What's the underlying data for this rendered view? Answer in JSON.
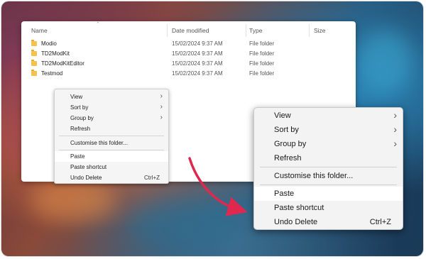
{
  "explorer": {
    "columns": [
      "Name",
      "Date modified",
      "Type",
      "Size"
    ],
    "rows": [
      {
        "name": "Modio",
        "date": "15/02/2024 9:37 AM",
        "type": "File folder",
        "icon": "folder-icon"
      },
      {
        "name": "TD2ModKit",
        "date": "15/02/2024 9:37 AM",
        "type": "File folder",
        "icon": "folder-icon"
      },
      {
        "name": "TD2ModKitEditor",
        "date": "15/02/2024 9:37 AM",
        "type": "File folder",
        "icon": "folder-icon"
      },
      {
        "name": "Testmod",
        "date": "15/02/2024 9:37 AM",
        "type": "File folder",
        "icon": "folder-icon"
      }
    ]
  },
  "context_menu": {
    "items": [
      {
        "label": "View",
        "submenu": true
      },
      {
        "label": "Sort by",
        "submenu": true
      },
      {
        "label": "Group by",
        "submenu": true
      },
      {
        "label": "Refresh"
      },
      {
        "label": "Customise this folder..."
      },
      {
        "label": "Paste",
        "highlighted": true
      },
      {
        "label": "Paste shortcut"
      },
      {
        "label": "Undo Delete",
        "shortcut": "Ctrl+Z"
      }
    ]
  },
  "colors": {
    "arrow": "#e0284f",
    "folder": "#f4c24f",
    "highlight": "#ffffff"
  }
}
